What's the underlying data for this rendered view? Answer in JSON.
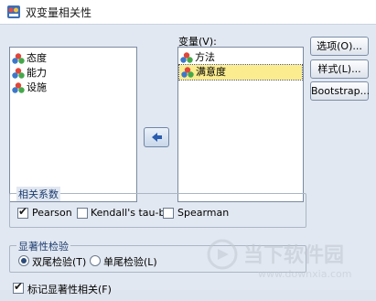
{
  "window": {
    "title": "双变量相关性"
  },
  "source_list": {
    "items": [
      "态度",
      "能力",
      "设施"
    ]
  },
  "target_list": {
    "label": "变量(V):",
    "items": [
      "方法",
      "满意度"
    ],
    "selected_index": 1
  },
  "buttons": {
    "options": "选项(O)...",
    "style": "样式(L)...",
    "bootstrap": "Bootstrap..."
  },
  "correlation": {
    "title": "相关系数",
    "pearson": {
      "label": "Pearson",
      "checked": true
    },
    "kendall": {
      "label": "Kendall's tau-b",
      "checked": false
    },
    "spearman": {
      "label": "Spearman",
      "checked": false
    }
  },
  "significance": {
    "title": "显著性检验",
    "two_tailed": {
      "label": "双尾检验(T)",
      "selected": true
    },
    "one_tailed": {
      "label": "单尾检验(L)",
      "selected": false
    }
  },
  "flag": {
    "label": "标记显著性相关(F)",
    "checked": true
  },
  "watermark": {
    "text": "当下软件园",
    "url": "www.downxia.com"
  }
}
